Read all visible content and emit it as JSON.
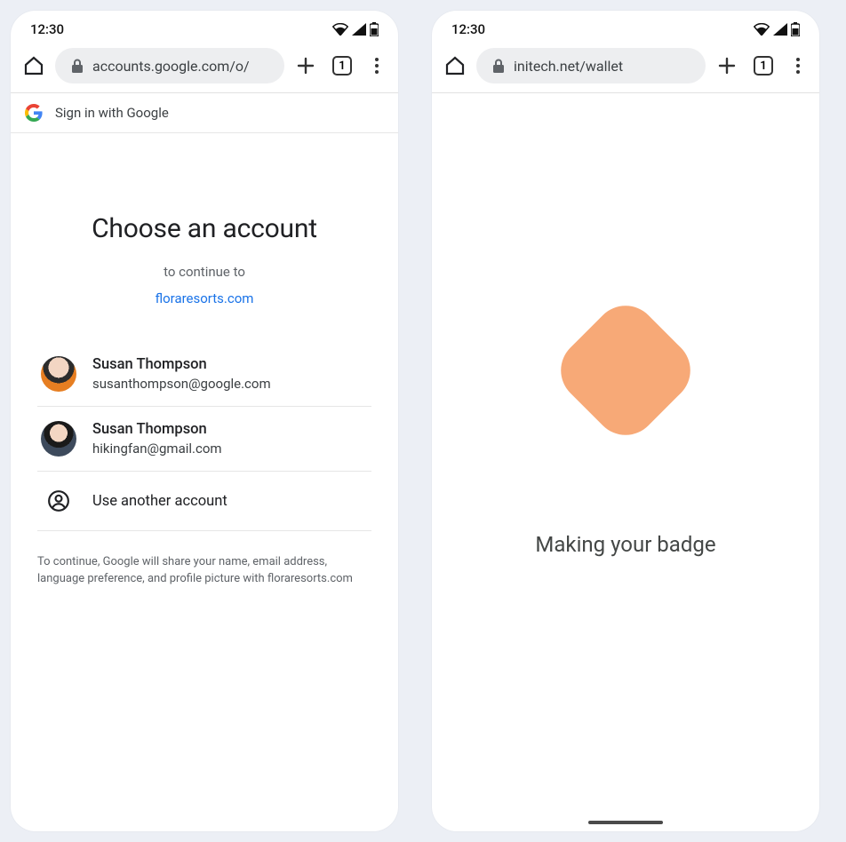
{
  "status": {
    "time": "12:30"
  },
  "left": {
    "url": "accounts.google.com/o/",
    "tab_count": "1",
    "signin_header": "Sign in with Google",
    "heading": "Choose an account",
    "subtext": "to continue to",
    "continue_to": "floraresorts.com",
    "accounts": [
      {
        "name": "Susan Thompson",
        "email": "susanthompson@google.com"
      },
      {
        "name": "Susan Thompson",
        "email": "hikingfan@gmail.com"
      }
    ],
    "use_another": "Use another account",
    "disclosure": "To continue, Google will share your name, email address, language preference, and profile picture with floraresorts.com"
  },
  "right": {
    "url": "initech.net/wallet",
    "tab_count": "1",
    "badge_text": "Making your badge"
  }
}
